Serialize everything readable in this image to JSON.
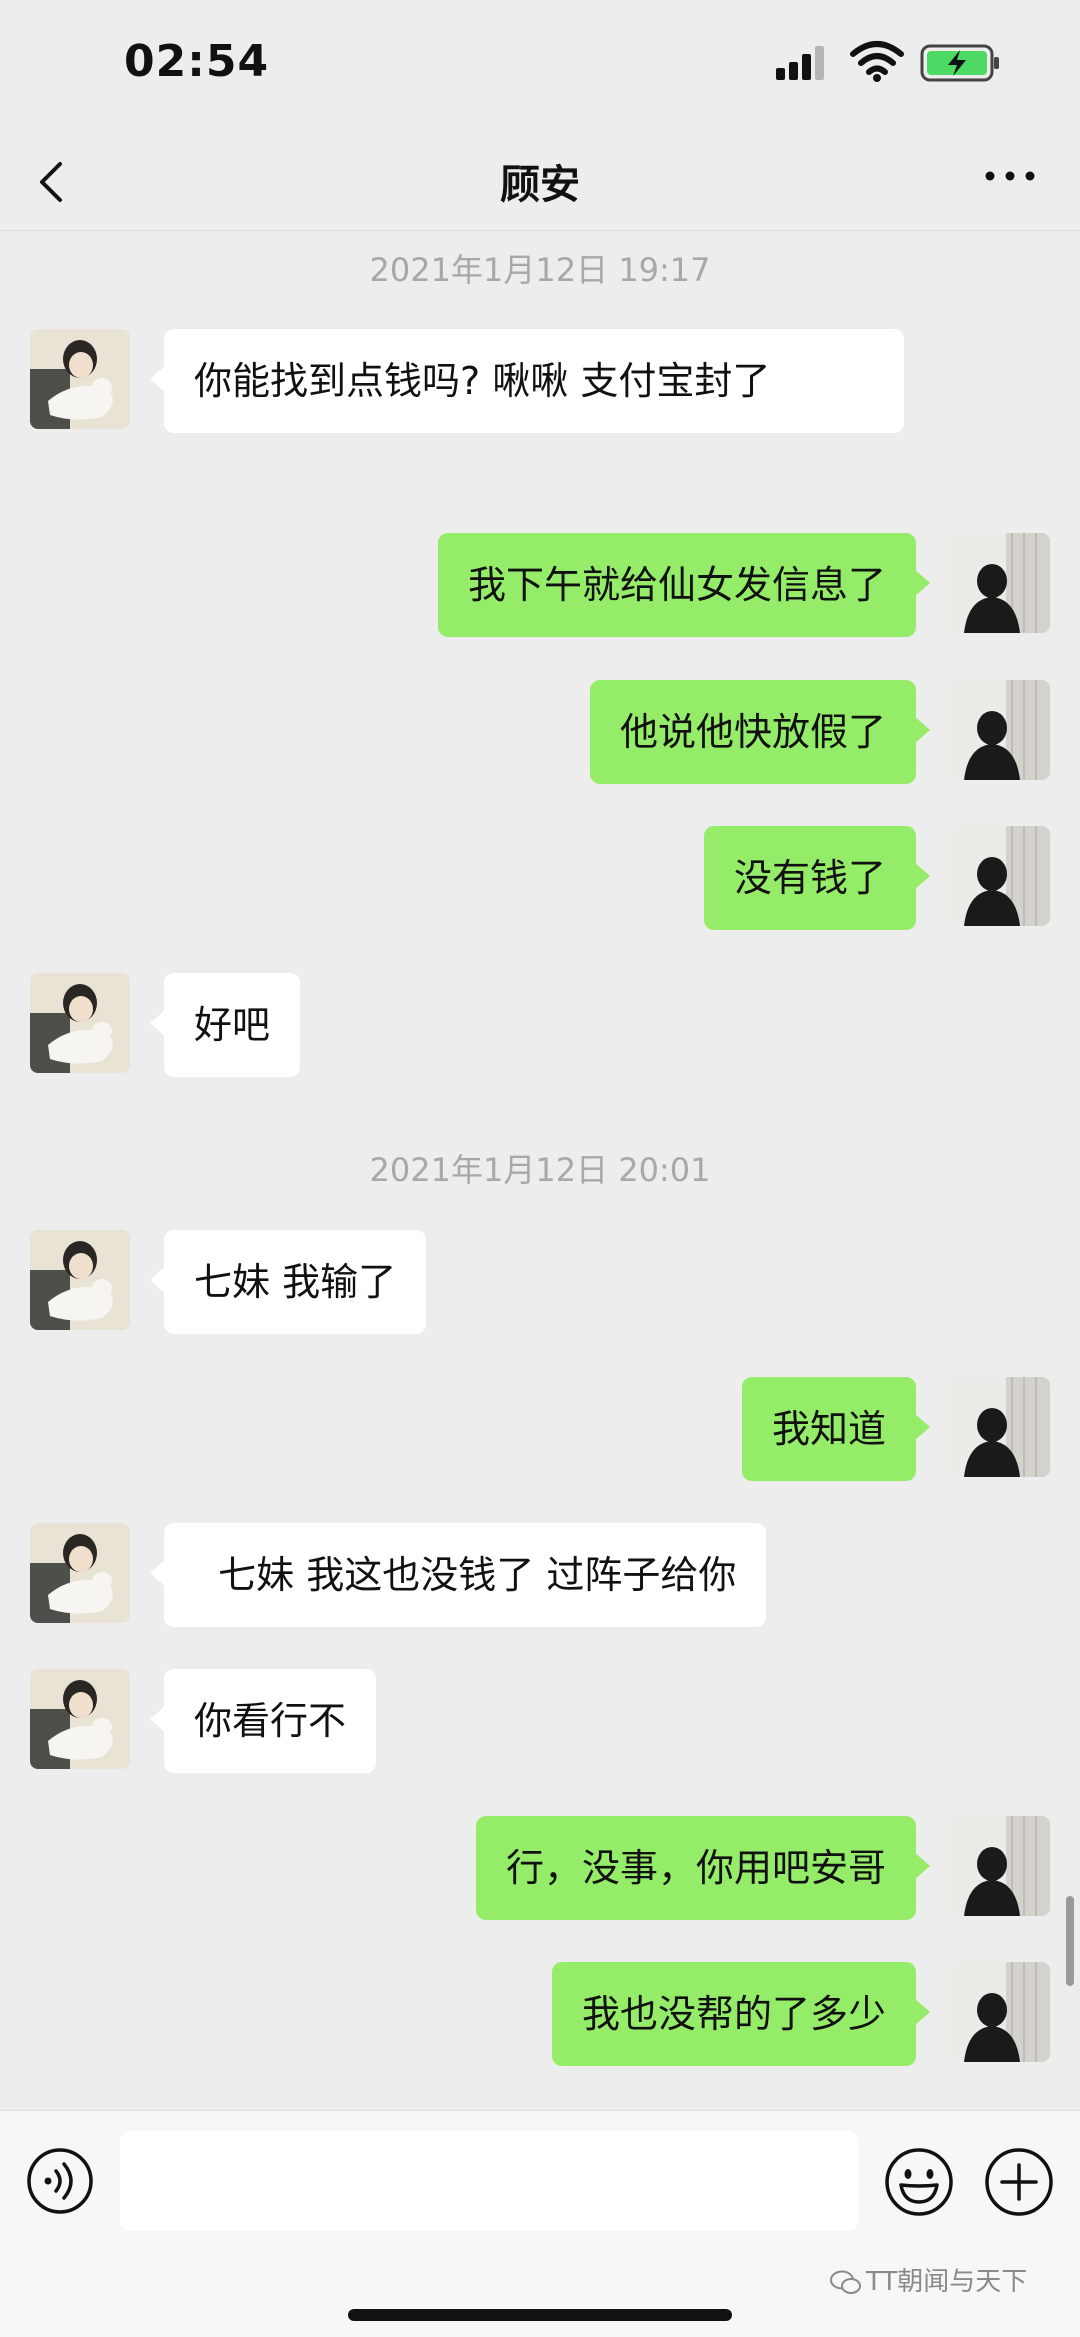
{
  "status_bar": {
    "time": "02:54"
  },
  "nav": {
    "title": "顾安",
    "back_icon": "chevron-left-icon",
    "more_icon": "more-dots-icon"
  },
  "messages": [
    {
      "type": "timestamp",
      "text": "2021年1月12日 19:17"
    },
    {
      "type": "in",
      "text": " 你能找到点钱吗?    啾啾  支付宝封了"
    },
    {
      "type": "out",
      "text": "我下午就给仙女发信息了"
    },
    {
      "type": "out",
      "text": "他说他快放假了"
    },
    {
      "type": "out",
      "text": "没有钱了"
    },
    {
      "type": "in",
      "text": "好吧"
    },
    {
      "type": "timestamp",
      "text": "2021年1月12日 20:01"
    },
    {
      "type": "in",
      "text": " 七妹 我输了"
    },
    {
      "type": "out",
      "text": "我知道"
    },
    {
      "type": "in",
      "text": "  七妹 我这也没钱了 过阵子给你"
    },
    {
      "type": "in",
      "text": "你看行不"
    },
    {
      "type": "out",
      "text": "行，没事，你用吧安哥"
    },
    {
      "type": "out",
      "text": "我也没帮的了多少"
    }
  ],
  "input": {
    "placeholder": "",
    "value": ""
  },
  "watermark": "TT朝闻与天下",
  "colors": {
    "background": "#ededed",
    "outgoing_bubble": "#95ec69",
    "incoming_bubble": "#ffffff",
    "timestamp": "#a8a8a8"
  }
}
